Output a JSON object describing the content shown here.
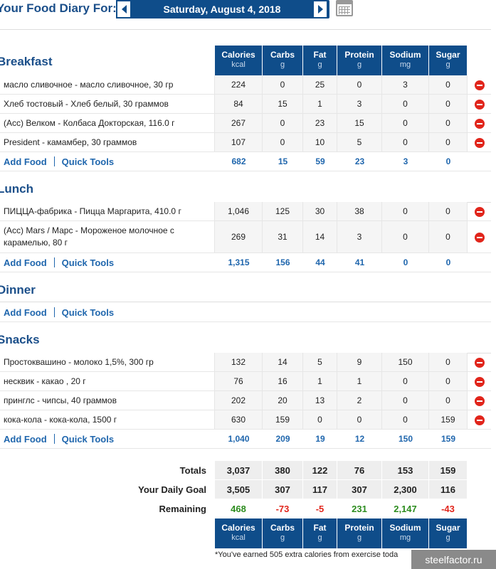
{
  "header": {
    "title": "Your Food Diary For:",
    "date": "Saturday, August 4, 2018",
    "prev_icon": "chevron-left-icon",
    "next_icon": "chevron-right-icon",
    "calendar_icon": "calendar-icon"
  },
  "columns": [
    {
      "name": "Calories",
      "unit": "kcal"
    },
    {
      "name": "Carbs",
      "unit": "g"
    },
    {
      "name": "Fat",
      "unit": "g"
    },
    {
      "name": "Protein",
      "unit": "g"
    },
    {
      "name": "Sodium",
      "unit": "mg"
    },
    {
      "name": "Sugar",
      "unit": "g"
    }
  ],
  "links": {
    "add_food": "Add Food",
    "quick_tools": "Quick Tools"
  },
  "meals": {
    "breakfast": {
      "title": "Breakfast",
      "items": [
        {
          "name": "масло сливочное - масло сливочное, 30 гр",
          "values": [
            "224",
            "0",
            "25",
            "0",
            "3",
            "0"
          ]
        },
        {
          "name": "Хлеб тостовый - Хлеб белый, 30 граммов",
          "values": [
            "84",
            "15",
            "1",
            "3",
            "0",
            "0"
          ]
        },
        {
          "name": "(Acc) Велком - Колбаса Докторская, 116.0 г",
          "values": [
            "267",
            "0",
            "23",
            "15",
            "0",
            "0"
          ]
        },
        {
          "name": "President - камамбер, 30 граммов",
          "values": [
            "107",
            "0",
            "10",
            "5",
            "0",
            "0"
          ]
        }
      ],
      "totals": [
        "682",
        "15",
        "59",
        "23",
        "3",
        "0"
      ]
    },
    "lunch": {
      "title": "Lunch",
      "items": [
        {
          "name": "ПИЦЦА-фабрика - Пицца Маргарита, 410.0 г",
          "values": [
            "1,046",
            "125",
            "30",
            "38",
            "0",
            "0"
          ]
        },
        {
          "name": "(Acc) Mars / Марс - Мороженое молочное с карамелью, 80 г",
          "values": [
            "269",
            "31",
            "14",
            "3",
            "0",
            "0"
          ]
        }
      ],
      "totals": [
        "1,315",
        "156",
        "44",
        "41",
        "0",
        "0"
      ]
    },
    "dinner": {
      "title": "Dinner"
    },
    "snacks": {
      "title": "Snacks",
      "items": [
        {
          "name": "Простоквашино - молоко 1,5%, 300 гр",
          "values": [
            "132",
            "14",
            "5",
            "9",
            "150",
            "0"
          ]
        },
        {
          "name": "несквик - какао , 20 г",
          "values": [
            "76",
            "16",
            "1",
            "1",
            "0",
            "0"
          ]
        },
        {
          "name": "принглс - чипсы, 40 граммов",
          "values": [
            "202",
            "20",
            "13",
            "2",
            "0",
            "0"
          ]
        },
        {
          "name": "кока-кола - кока-кола, 1500 г",
          "values": [
            "630",
            "159",
            "0",
            "0",
            "0",
            "159"
          ]
        }
      ],
      "totals": [
        "1,040",
        "209",
        "19",
        "12",
        "150",
        "159"
      ]
    }
  },
  "summary": {
    "totals_label": "Totals",
    "totals": [
      "3,037",
      "380",
      "122",
      "76",
      "153",
      "159"
    ],
    "goal_label": "Your Daily Goal",
    "goal": [
      "3,505",
      "307",
      "117",
      "307",
      "2,300",
      "116"
    ],
    "remaining_label": "Remaining",
    "remaining": [
      "468",
      "-73",
      "-5",
      "231",
      "2,147",
      "-43"
    ],
    "remaining_colors": [
      "#2c8c1e",
      "#e1251b"
    ]
  },
  "footnote": "*You've earned 505 extra calories from exercise toda",
  "watermark": "steelfactor.ru"
}
